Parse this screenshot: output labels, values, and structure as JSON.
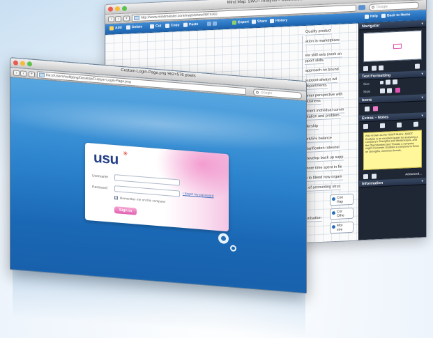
{
  "back_window": {
    "title": "Mind Map: SWOT Analysis – MindMeister",
    "url": "http://www.mindmeister.com/maps/show/4974382",
    "search_placeholder": "Google",
    "toolbar": {
      "add": "Add",
      "delete": "Delete",
      "cut": "Cut",
      "copy": "Copy",
      "paste": "Paste",
      "export": "Export",
      "share": "Share",
      "history": "History",
      "help": "Help",
      "back_to_home": "Back to Home"
    },
    "map_nodes": [
      "Quality product",
      "ation in marketplace",
      "ew skill sets (work an",
      "pport skills",
      "approach-no bound",
      "support-always wil",
      "departments",
      "omer perspective with",
      "ousiness",
      "ficient individual comm",
      "ntation and problem-",
      "dership",
      "ork/5% balance",
      "clarification roles/ret",
      "Develop back up supp",
      "more time spent in fie",
      "n to blend new organi",
      "k of accounting struc"
    ],
    "topics": [
      {
        "label": "Con",
        "sub": "Hap"
      },
      {
        "label": "Cor",
        "sub": "Othe"
      },
      {
        "label": "Mor",
        "sub": "stre"
      }
    ],
    "left_fragment": "itunisation",
    "sidebar": {
      "navigator": "Navigator",
      "text_formatting": "Text Formatting",
      "size_label": "Size",
      "style_label": "Style",
      "icons": "Icons",
      "extras": "Extras – Notes",
      "note_text": "Also known as the TOWS Matrix, SWOT Analysis is an excellent guide for analyzing a company's Strengths and Weaknesses, and the Opportunities and Threats a company might encounter. Enables a company to focus on strengths, minimize threats,",
      "advanced": "Advanced...",
      "information": "Information"
    }
  },
  "front_window": {
    "title": "Custom-Login-Page.png 962×576 pixels",
    "url": "file:///Users/wolfgang/Desktop/Custom-Login-Page.png",
    "search_placeholder": "Google",
    "login": {
      "logo": "usu",
      "username_label": "Username",
      "password_label": "Password",
      "forgot_link": "I forgot my password",
      "remember_label": "Remember me on this computer",
      "remember_checked": true,
      "signin_button": "Sign in"
    }
  },
  "colors": {
    "mindmeister_toolbar": "#1b62ad",
    "sidebar_bg": "#1f2734",
    "login_bg": "#2e86cf",
    "accent_pink": "#e060b0",
    "logo_blue": "#243f88",
    "logo_red": "#d9271c",
    "note_yellow": "#fff79a"
  }
}
